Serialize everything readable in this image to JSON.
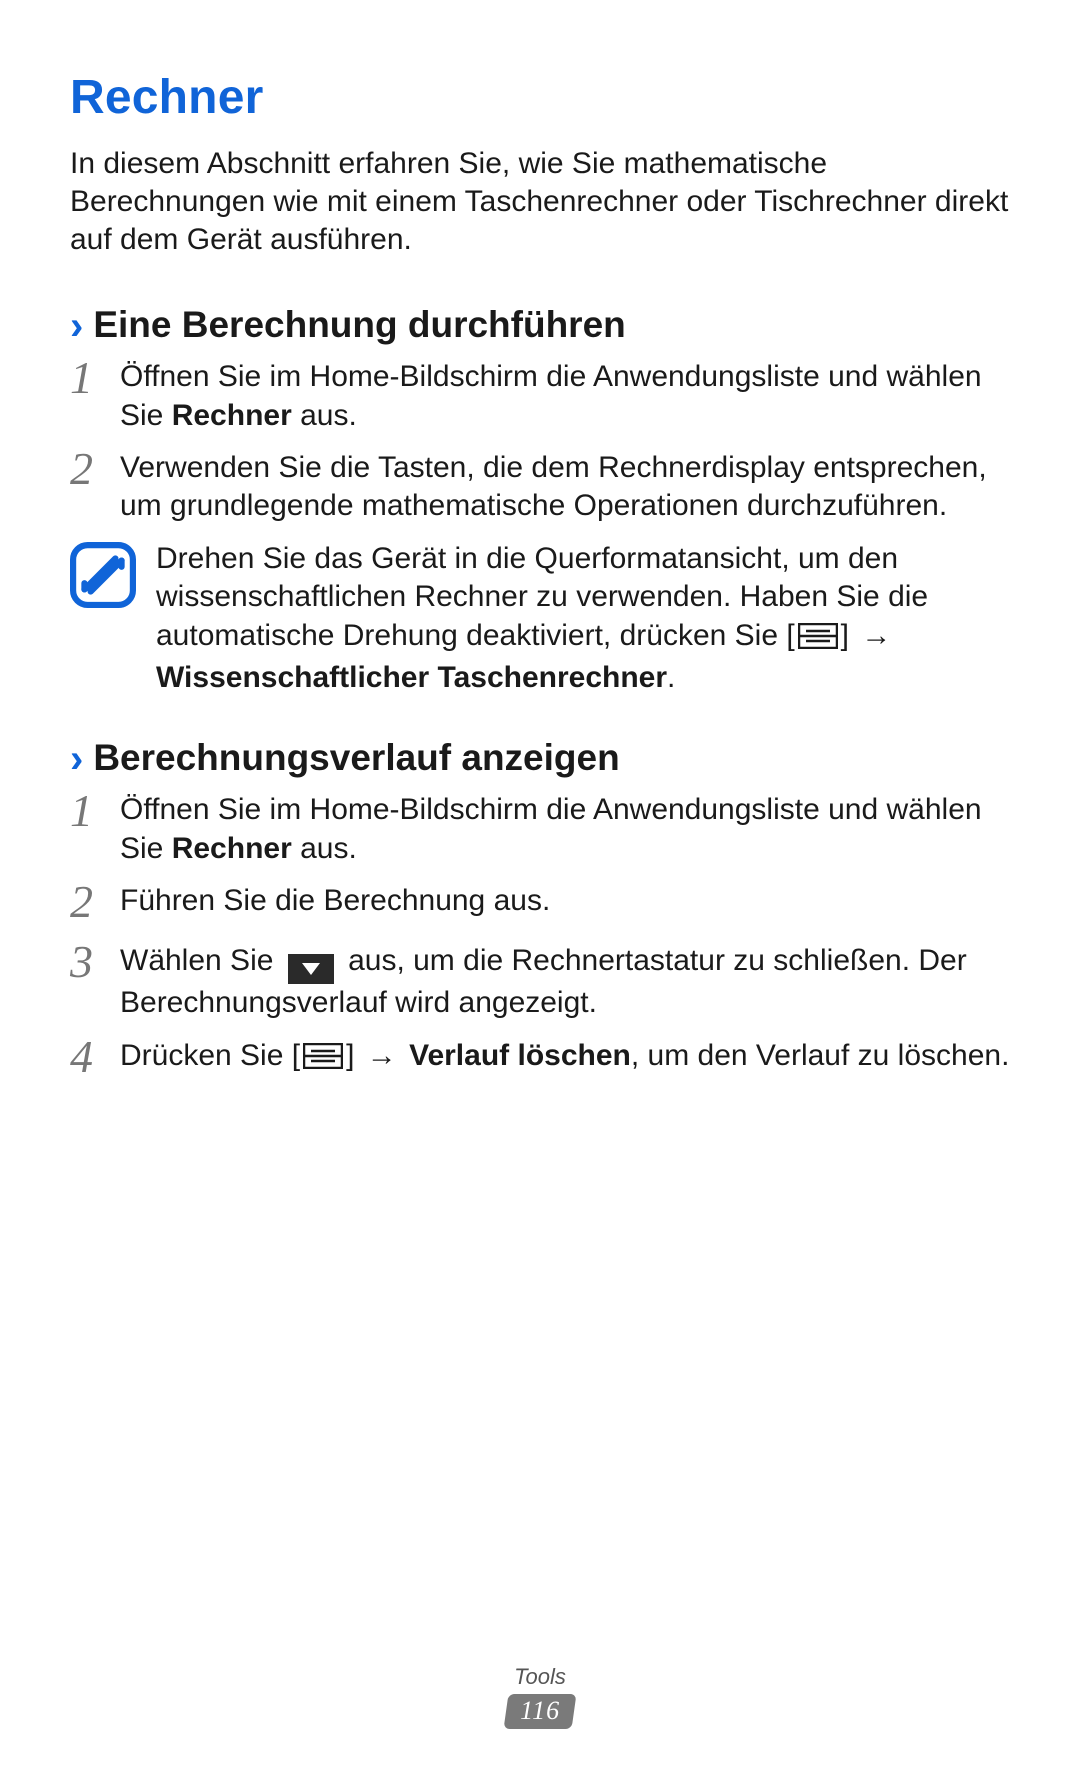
{
  "title": "Rechner",
  "intro": "In diesem Abschnitt erfahren Sie, wie Sie mathematische Berechnungen wie mit einem Taschenrechner oder Tischrechner direkt auf dem Gerät ausführen.",
  "section1": {
    "chevron": "›",
    "heading": "Eine Berechnung durchführen",
    "steps": {
      "s1_num": "1",
      "s1_a": "Öffnen Sie im Home-Bildschirm die Anwendungsliste und wählen Sie ",
      "s1_bold": "Rechner",
      "s1_b": " aus.",
      "s2_num": "2",
      "s2": "Verwenden Sie die Tasten, die dem Rechnerdisplay entsprechen, um grundlegende mathematische Operationen durchzuführen."
    },
    "note": {
      "a": "Drehen Sie das Gerät in die Querformatansicht, um den wissenschaftlichen Rechner zu verwenden. Haben Sie die automatische Drehung deaktiviert, drücken Sie [",
      "b": "] ",
      "arrow": "→",
      "c": " ",
      "bold": "Wissenschaftlicher Taschenrechner",
      "d": "."
    }
  },
  "section2": {
    "chevron": "›",
    "heading": "Berechnungsverlauf anzeigen",
    "steps": {
      "s1_num": "1",
      "s1_a": "Öffnen Sie im Home-Bildschirm die Anwendungsliste und wählen Sie ",
      "s1_bold": "Rechner",
      "s1_b": " aus.",
      "s2_num": "2",
      "s2": "Führen Sie die Berechnung aus.",
      "s3_num": "3",
      "s3_a": "Wählen Sie ",
      "s3_b": " aus, um die Rechnertastatur zu schließen. Der Berechnungsverlauf wird angezeigt.",
      "s4_num": "4",
      "s4_a": "Drücken Sie [",
      "s4_b": "] ",
      "s4_arrow": "→",
      "s4_c": " ",
      "s4_bold": "Verlauf löschen",
      "s4_d": ", um den Verlauf zu löschen."
    }
  },
  "footer": {
    "category": "Tools",
    "page": "116"
  }
}
